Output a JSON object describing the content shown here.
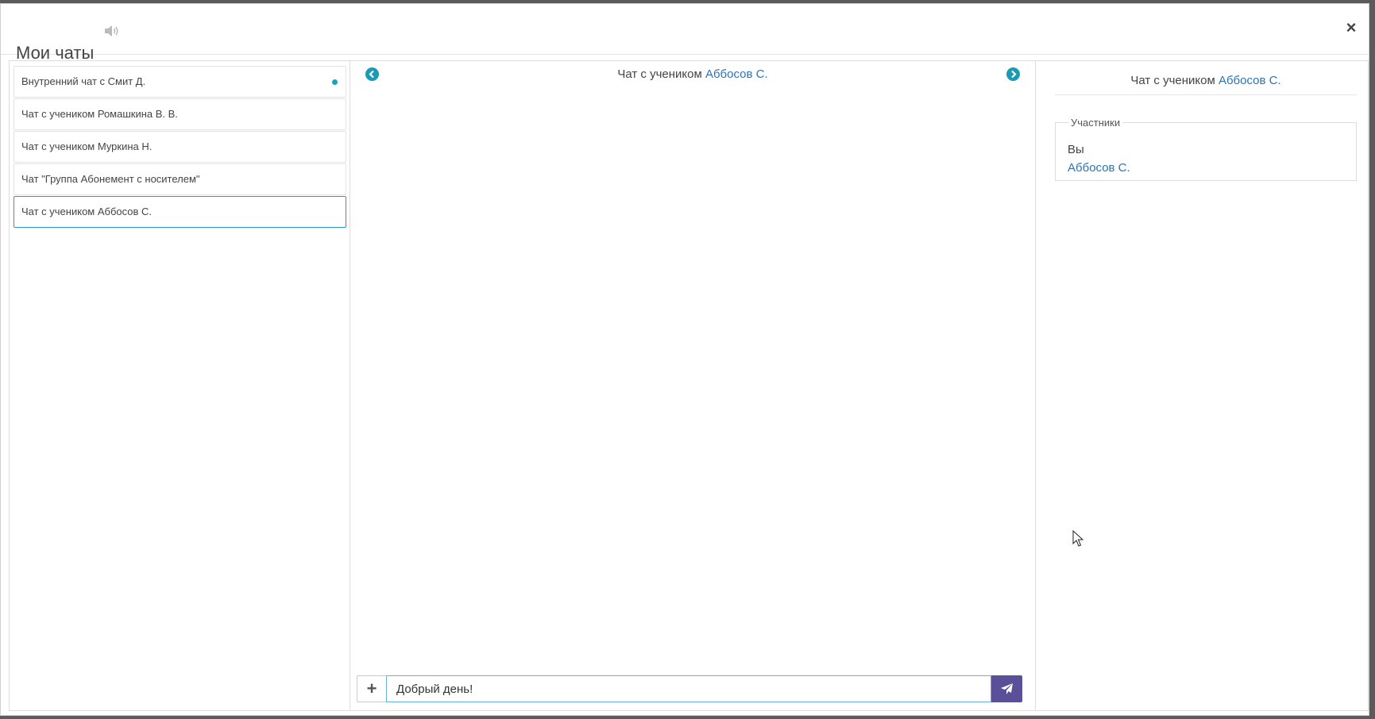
{
  "header": {
    "title": "Мои чаты"
  },
  "chats": [
    {
      "label": "Внутренний чат с Смит Д.",
      "unread": true
    },
    {
      "label": "Чат с учеником Ромашкина В. В."
    },
    {
      "label": "Чат с учеником Муркина Н."
    },
    {
      "label": "Чат \"Группа Абонемент с носителем\""
    },
    {
      "label": "Чат с учеником Аббосов С.",
      "active": true
    }
  ],
  "conversation": {
    "title_prefix": "Чат с учеником",
    "student": "Аббосов С.",
    "input_value": "Добрый день!"
  },
  "info": {
    "title_prefix": "Чат с учеником",
    "student": "Аббосов С.",
    "participants_label": "Участники",
    "participants": [
      "Вы",
      "Аббосов С."
    ]
  },
  "colors": {
    "accent_teal": "#1a9bb3",
    "link_blue": "#2a74b8",
    "send_purple": "#5a4f99",
    "active_border": "#2a96d5"
  }
}
